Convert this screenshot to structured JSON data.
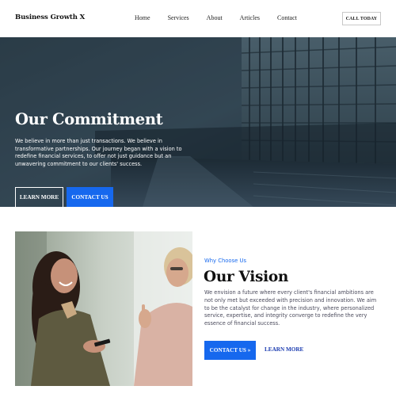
{
  "nav": {
    "brand": "Business Growth X",
    "items": [
      {
        "label": "Home"
      },
      {
        "label": "Services"
      },
      {
        "label": "About"
      },
      {
        "label": "Articles"
      },
      {
        "label": "Contact"
      }
    ],
    "cta_label": "CALL TODAY"
  },
  "hero": {
    "title": "Our Commitment",
    "text": "We believe in more than just transactions. We believe in transformative partnerships. Our journey began with a vision to redefine financial services, to offer not just guidance but an unwavering commitment to our clients' success.",
    "learn_more_label": "LEARN MORE",
    "contact_label": "CONTACT US"
  },
  "vision": {
    "eyebrow": "Why Choose Us",
    "title": "Our Vision",
    "text": "We envision a future where every client's financial ambitions are not only met but exceeded with precision and innovation. We aim to be the catalyst for change in the industry, where personalized service, expertise, and integrity converge to redefine the very essence of financial success.",
    "contact_label": "CONTACT US »",
    "learn_more_label": "LEARN MORE"
  },
  "colors": {
    "accent": "#1668ee",
    "hero_overlay": "#2c3d49"
  }
}
